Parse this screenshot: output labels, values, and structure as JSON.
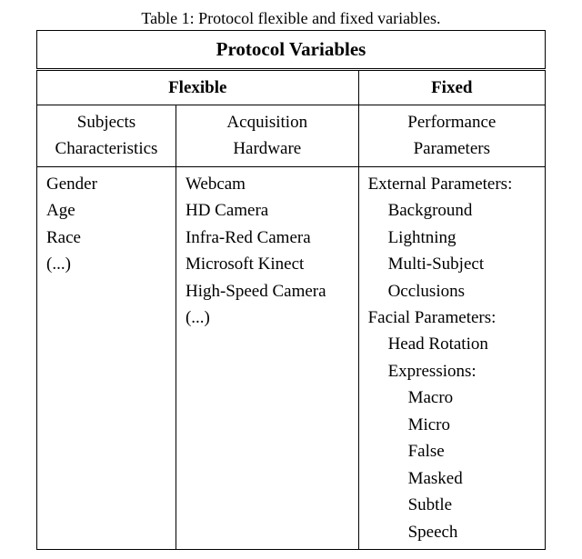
{
  "caption": "Table 1: Protocol flexible and fixed variables.",
  "title": "Protocol Variables",
  "groups": {
    "flexible": "Flexible",
    "fixed": "Fixed"
  },
  "subheads": {
    "subjects_l1": "Subjects",
    "subjects_l2": "Characteristics",
    "acq_l1": "Acquisition",
    "acq_l2": "Hardware",
    "perf_l1": "Performance",
    "perf_l2": "Parameters"
  },
  "col1": {
    "l1": "Gender",
    "l2": "Age",
    "l3": "Race",
    "l4": "(...)"
  },
  "col2": {
    "l1": "Webcam",
    "l2": "HD Camera",
    "l3": "Infra-Red Camera",
    "l4": "Microsoft Kinect",
    "l5": "High-Speed Camera",
    "l6": "(...)"
  },
  "col3": {
    "l1": "External Parameters:",
    "l2": "Background",
    "l3": "Lightning",
    "l4": "Multi-Subject",
    "l5": "Occlusions",
    "l6": "Facial Parameters:",
    "l7": "Head Rotation",
    "l8": "Expressions:",
    "l9": "Macro",
    "l10": "Micro",
    "l11": "False",
    "l12": "Masked",
    "l13": "Subtle",
    "l14": "Speech"
  }
}
